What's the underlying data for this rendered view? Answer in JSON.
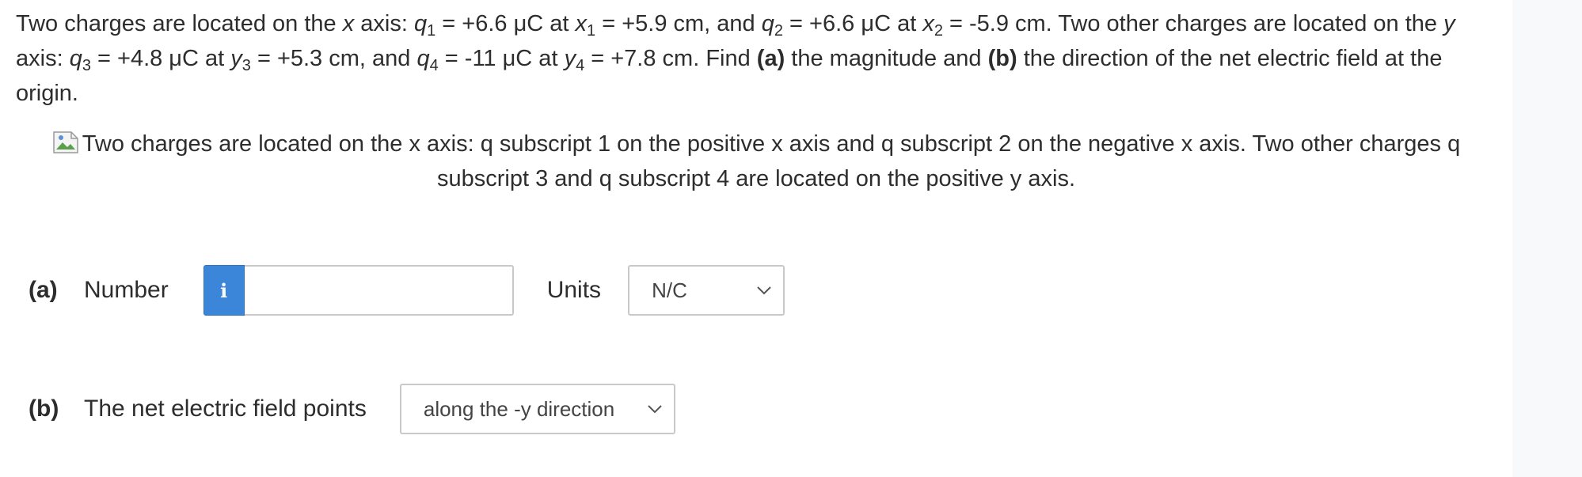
{
  "question": {
    "s1": "Two charges are located on the ",
    "xvar": "x",
    "s2": " axis: ",
    "q": "q",
    "sub1": "1",
    "s3": " = +6.6 μC at ",
    "x": "x",
    "s4": " = +5.9 cm, and ",
    "sub2": "2",
    "s5": " = +6.6 μC at ",
    "s6": " = -5.9 cm. Two other charges are located on the ",
    "yvar": "y",
    "s7": " axis: ",
    "sub3": "3",
    "s8": " = +4.8 μC at ",
    "s9": " = +5.3 cm, and ",
    "sub4": "4",
    "s10": " = -11 μC at ",
    "s11": " = +7.8 cm. Find ",
    "a_label": "(a)",
    "s12": " the magnitude and ",
    "b_label": "(b)",
    "s13": " the direction of the net electric field at the origin."
  },
  "figure": {
    "alt_text": "Two charges are located on the x axis: q subscript 1 on the positive x axis and q subscript 2 on the negative x axis. Two other charges q subscript 3 and q subscript 4 are located on the positive y axis."
  },
  "part_a": {
    "label": "(a)",
    "text": "Number",
    "info_glyph": "i",
    "input_value": "",
    "units_label": "Units",
    "units_selected": "N/C"
  },
  "part_b": {
    "label": "(b)",
    "text": "The net electric field points",
    "direction_selected": "along the -y direction"
  },
  "colors": {
    "info_button": "#3b86d8",
    "border": "#c9c9c9",
    "text": "#2d2d2d"
  },
  "icons": {
    "info": "info-icon",
    "dropdown": "chevron-down-icon",
    "broken_image": "broken-image-icon"
  }
}
